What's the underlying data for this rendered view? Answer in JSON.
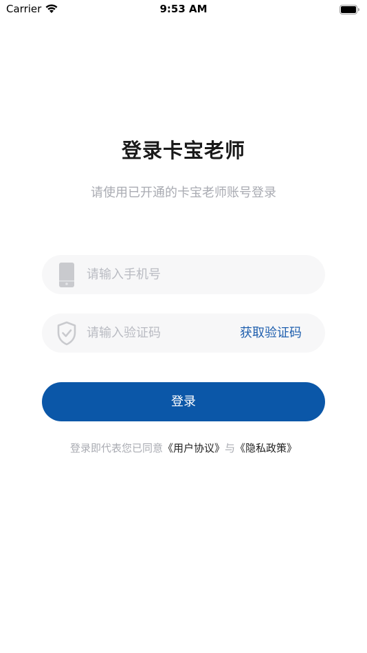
{
  "status_bar": {
    "carrier": "Carrier",
    "time": "9:53 AM"
  },
  "login": {
    "title": "登录卡宝老师",
    "subtitle": "请使用已开通的卡宝老师账号登录",
    "phone_placeholder": "请输入手机号",
    "code_placeholder": "请输入验证码",
    "get_code_label": "获取验证码",
    "submit_label": "登录",
    "agreement": {
      "prefix": "登录即代表您已同意",
      "user_agreement": "《用户协议》",
      "conjunction": "与",
      "privacy_policy": "《隐私政策》"
    }
  },
  "icons": {
    "phone_field": "mobile-phone-icon",
    "code_field": "shield-check-icon"
  },
  "colors": {
    "primary": "#0b57a8",
    "link": "#1f5fae",
    "placeholder": "#b9bbc2",
    "field_bg": "#f7f7f8"
  }
}
